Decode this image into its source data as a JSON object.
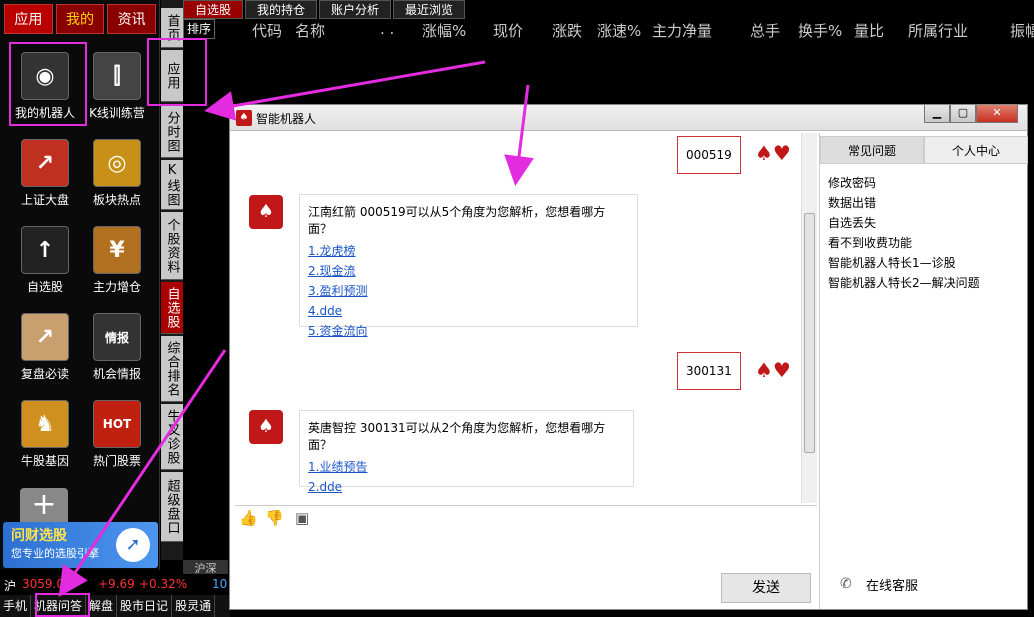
{
  "left_panel": {
    "tabs": [
      "应用",
      "我的",
      "资讯"
    ],
    "apps": [
      {
        "label": "我的机器人",
        "icon": "robot-icon",
        "glyph": "◉"
      },
      {
        "label": "K线训练营",
        "icon": "kline-icon",
        "glyph": "⫿"
      },
      {
        "label": "上证大盘",
        "icon": "index-chart-icon",
        "glyph": "↗"
      },
      {
        "label": "板块热点",
        "icon": "radar-icon",
        "glyph": "◎"
      },
      {
        "label": "自选股",
        "icon": "watchlist-icon",
        "glyph": "↑"
      },
      {
        "label": "主力增仓",
        "icon": "money-bag-icon",
        "glyph": "¥"
      },
      {
        "label": "复盘必读",
        "icon": "review-icon",
        "glyph": "↗"
      },
      {
        "label": "机会情报",
        "icon": "intel-icon",
        "glyph": "情报"
      },
      {
        "label": "牛股基因",
        "icon": "bull-icon",
        "glyph": "♞"
      },
      {
        "label": "热门股票",
        "icon": "hot-fire-icon",
        "glyph": "HOT"
      }
    ],
    "add_glyph": "+",
    "banner_title": "问财选股",
    "banner_sub": "您专业的选股引擎"
  },
  "vertical_tabs": [
    "首页",
    "应用",
    "分时图",
    "K线图",
    "个股资料",
    "自选股",
    "综合排名",
    "牛叉诊股",
    "超级盘口"
  ],
  "hushen_label": "沪深",
  "top_tabs": [
    "自选股",
    "我的持仓",
    "账户分析",
    "最近浏览"
  ],
  "sort_label": "排序",
  "columns": [
    "代码",
    "名称",
    ". .",
    "涨幅%",
    "现价",
    "涨跌",
    "涨速%",
    "主力净量",
    "总手",
    "换手%",
    "量比",
    "所属行业",
    "振幅"
  ],
  "ticker": {
    "market": "沪",
    "index": "3059.0",
    "change": "+9.69",
    "pct": "+0.32%",
    "extra": "10"
  },
  "bottom_buttons": [
    "手机",
    "机器问答",
    "解盘",
    "股市日记",
    "股灵通"
  ],
  "robot_window": {
    "title": "智能机器人",
    "msg1_code": "000519",
    "reply1_question": "江南红箭 000519可以从5个角度为您解析，您想看哪方面？",
    "reply1_links": [
      "1.龙虎榜",
      "2.现金流",
      "3.盈利预测",
      "4.dde",
      "5.资金流向"
    ],
    "msg2_code": "300131",
    "reply2_question": "英唐智控 300131可以从2个角度为您解析，您想看哪方面？",
    "reply2_links": [
      "1.业绩预告",
      "2.dde"
    ],
    "send_label": "发送",
    "side_tabs": [
      "常见问题",
      "个人中心"
    ],
    "faq": [
      "修改密码",
      "数据出错",
      "自选丢失",
      "看不到收费功能",
      "智能机器人特长1—诊股",
      "智能机器人特长2—解决问题"
    ],
    "online_service": "在线客服"
  },
  "colors": {
    "accent": "#c01818",
    "annotation": "#e32be0",
    "link": "#1a55c6"
  }
}
